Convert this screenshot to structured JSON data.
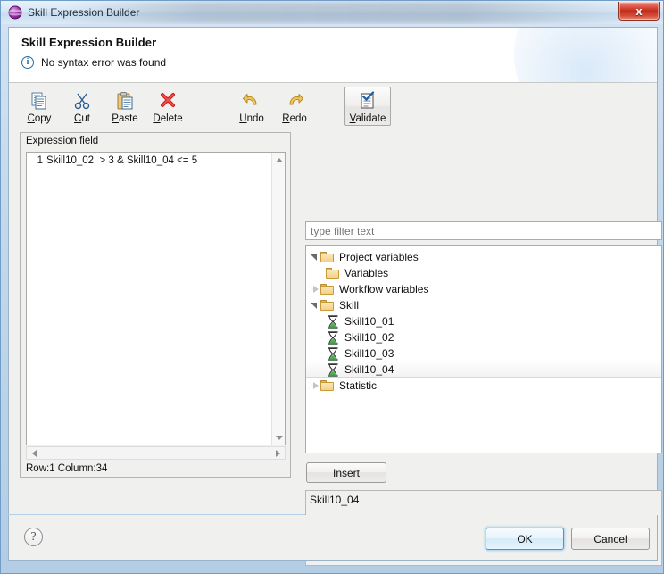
{
  "window": {
    "title": "Skill Expression Builder",
    "icon": "purple-sphere-icon",
    "close_label": "x"
  },
  "header": {
    "title": "Skill Expression Builder",
    "message": "No syntax error was found",
    "info_icon": "info-circle-icon"
  },
  "toolbar": {
    "items": [
      {
        "label_pre": "",
        "label_key": "C",
        "label_post": "opy",
        "full": "Copy",
        "icon": "copy-icon"
      },
      {
        "label_pre": "",
        "label_key": "C",
        "label_post": "ut",
        "full": "Cut",
        "icon": "cut-icon"
      },
      {
        "label_pre": "",
        "label_key": "P",
        "label_post": "aste",
        "full": "Paste",
        "icon": "paste-icon"
      },
      {
        "label_pre": "",
        "label_key": "D",
        "label_post": "elete",
        "full": "Delete",
        "icon": "delete-icon"
      },
      {
        "label_pre": "",
        "label_key": "U",
        "label_post": "ndo",
        "full": "Undo",
        "icon": "undo-icon"
      },
      {
        "label_pre": "",
        "label_key": "R",
        "label_post": "edo",
        "full": "Redo",
        "icon": "redo-icon"
      }
    ],
    "validate": {
      "label_key": "V",
      "label_post": "alidate",
      "full": "Validate",
      "icon": "validate-icon"
    }
  },
  "expression_pane": {
    "title": "Expression field",
    "line_number": "1",
    "code": "Skill10_02  > 3 & Skill10_04 <= 5",
    "status": "Row:1 Column:34"
  },
  "filter": {
    "placeholder": "type filter text",
    "value": ""
  },
  "tree": {
    "nodes": [
      {
        "label": "Project variables",
        "icon": "folder-icon",
        "state": "expanded",
        "level": 1,
        "selected": false
      },
      {
        "label": "Variables",
        "icon": "folder-icon",
        "state": "leaf",
        "level": 2,
        "selected": false
      },
      {
        "label": "Workflow variables",
        "icon": "folder-icon",
        "state": "collapsed",
        "level": 1,
        "selected": false
      },
      {
        "label": "Skill",
        "icon": "folder-icon",
        "state": "expanded",
        "level": 1,
        "selected": false
      },
      {
        "label": "Skill10_01",
        "icon": "skill-icon",
        "state": "leaf",
        "level": 2,
        "selected": false
      },
      {
        "label": "Skill10_02",
        "icon": "skill-icon",
        "state": "leaf",
        "level": 2,
        "selected": false
      },
      {
        "label": "Skill10_03",
        "icon": "skill-icon",
        "state": "leaf",
        "level": 2,
        "selected": false
      },
      {
        "label": "Skill10_04",
        "icon": "skill-icon",
        "state": "leaf",
        "level": 2,
        "selected": true
      },
      {
        "label": "Statistic",
        "icon": "folder-icon",
        "state": "collapsed",
        "level": 1,
        "selected": false
      }
    ]
  },
  "insert": {
    "label": "Insert"
  },
  "preview": {
    "value": "Skill10_04"
  },
  "footer": {
    "help_label": "?",
    "ok_label": "OK",
    "cancel_label": "Cancel"
  },
  "colors": {
    "accent_blue": "#3c9ad4",
    "close_red": "#c32b18",
    "folder_yellow": "#f3d089",
    "skill_green": "#3fa84a",
    "info_blue": "#2a6aa8",
    "delete_red": "#d42020",
    "undo_gold": "#e0a921"
  }
}
